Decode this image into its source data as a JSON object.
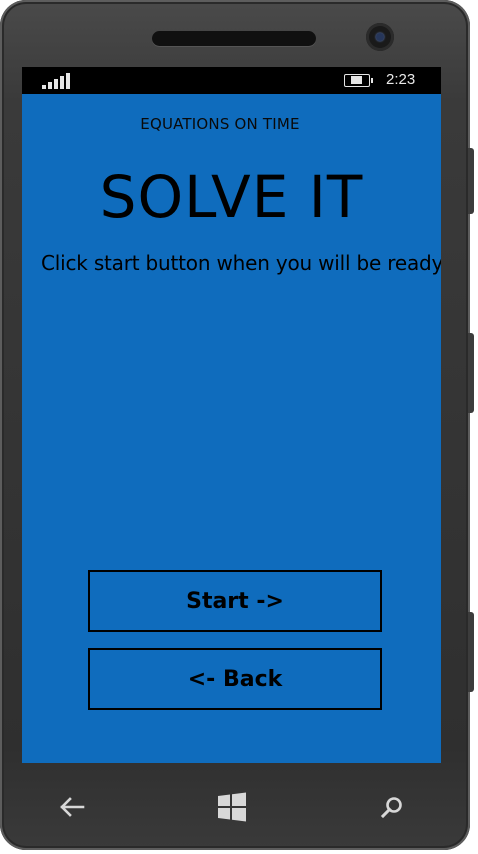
{
  "statusbar": {
    "signal_icon": "signal-strength-icon",
    "battery_icon": "battery-charging-icon",
    "time": "2:23"
  },
  "app": {
    "title": "EQUATIONS ON TIME",
    "heading": "SOLVE IT",
    "instruction": "Click start button when you will be ready"
  },
  "buttons": {
    "start_label": "Start ->",
    "back_label": "<- Back"
  },
  "navbar": {
    "back_icon": "back-arrow-icon",
    "windows_icon": "windows-logo-icon",
    "search_icon": "search-icon"
  },
  "colors": {
    "screen_background": "#0f6cbd",
    "statusbar_background": "#000000",
    "text": "#000000",
    "phone_body": "#333333"
  }
}
